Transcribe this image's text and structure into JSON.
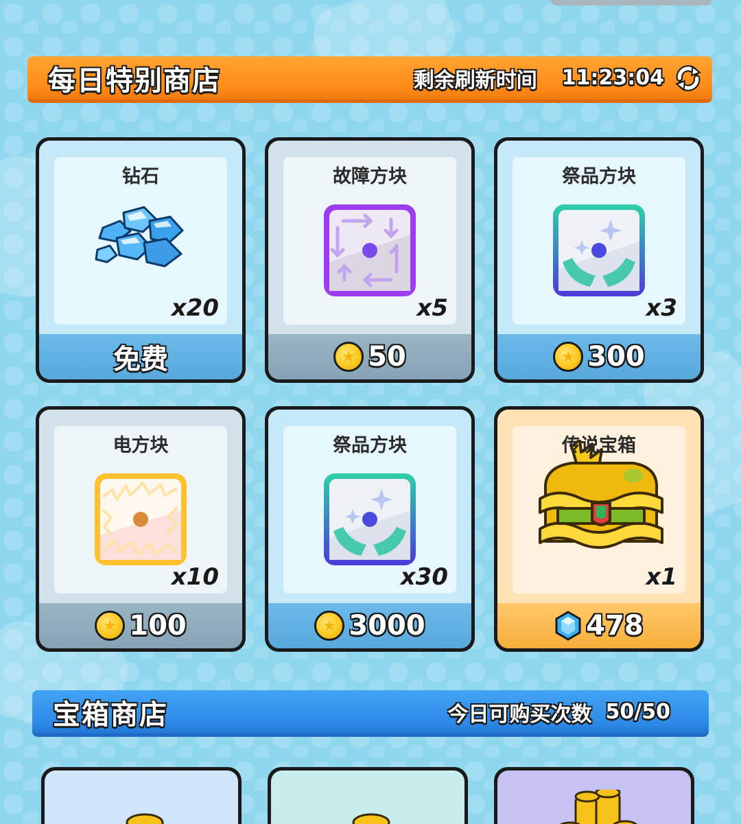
{
  "daily_shop": {
    "title": "每日特别商店",
    "refresh_label": "剩余刷新时间",
    "refresh_time": "11:23:04"
  },
  "items": [
    {
      "name": "钻石",
      "qty": "x20",
      "price": "免费",
      "price_type": "free",
      "icon": "diamond-pile-icon"
    },
    {
      "name": "故障方块",
      "qty": "x5",
      "price": "50",
      "price_type": "coin",
      "icon": "glitch-block-icon"
    },
    {
      "name": "祭品方块",
      "qty": "x3",
      "price": "300",
      "price_type": "coin",
      "icon": "offering-block-icon"
    },
    {
      "name": "电方块",
      "qty": "x10",
      "price": "100",
      "price_type": "coin",
      "icon": "electric-block-icon"
    },
    {
      "name": "祭品方块",
      "qty": "x30",
      "price": "3000",
      "price_type": "coin",
      "icon": "offering-block-icon"
    },
    {
      "name": "传说宝箱",
      "qty": "x1",
      "price": "478",
      "price_type": "gem",
      "icon": "legendary-chest-icon"
    }
  ],
  "chest_shop": {
    "title": "宝箱商店",
    "purchase_label": "今日可购买次数",
    "purchase_count": "50/50"
  },
  "colors": {
    "background": "#8fd6ef",
    "daily_banner": "#ff8c1a",
    "chest_banner": "#2f8ae8",
    "coin": "#fcc81e"
  }
}
